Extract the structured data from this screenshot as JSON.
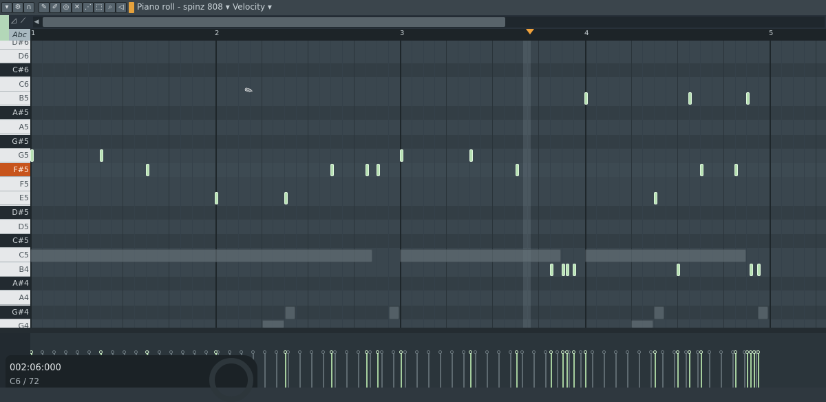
{
  "toolbar": {
    "title": "Piano roll - spinz 808",
    "title_arrow": "▾",
    "mode": "Velocity",
    "mode_arrow": "▾",
    "icons": [
      "menu-arrow-icon",
      "wrench-icon",
      "magnet-icon",
      "pencil-icon",
      "paint-brush-icon",
      "delete-icon",
      "mute-icon",
      "slice-icon",
      "select-icon",
      "zoom-icon",
      "playback-icon"
    ]
  },
  "ruler": {
    "bars": [
      "1",
      "2",
      "3",
      "4",
      "5"
    ]
  },
  "tool_label": "Abc",
  "keys": [
    "D#6",
    "D6",
    "C#6",
    "C6",
    "B5",
    "A#5",
    "A5",
    "G#5",
    "G5",
    "F#5",
    "F5",
    "E5",
    "D#5",
    "D5",
    "C#5",
    "C5",
    "B4",
    "A#4",
    "A4",
    "G#4",
    "G4"
  ],
  "active_key": "F#5",
  "status": {
    "time": "002:06:000",
    "note_info": "C6 / 72"
  },
  "colors": {
    "note": "#b7e1b3",
    "active_key": "#c7541c",
    "playhead": "#f0a23c"
  }
}
